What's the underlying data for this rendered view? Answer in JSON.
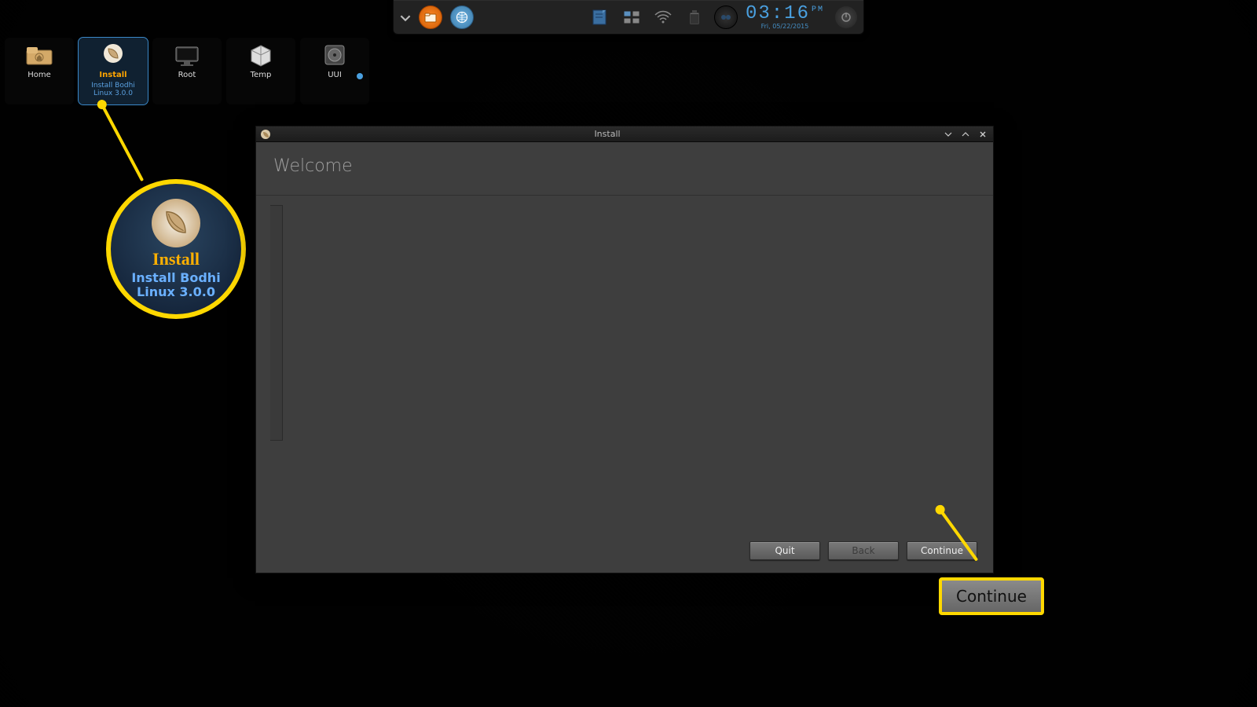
{
  "shelf": {
    "clock_time": "03:16",
    "clock_suffix": "PM",
    "clock_date": "Fri, 05/22/2015"
  },
  "desktop": {
    "icons": [
      {
        "label": "Home"
      },
      {
        "label_top": "Install",
        "label_bottom": "Install Bodhi Linux 3.0.0"
      },
      {
        "label": "Root"
      },
      {
        "label": "Temp"
      },
      {
        "label": "UUI"
      }
    ]
  },
  "callout_big": {
    "title": "Install",
    "subtitle": "Install Bodhi Linux 3.0.0"
  },
  "installer": {
    "window_title": "Install",
    "heading": "Welcome",
    "buttons": {
      "quit": "Quit",
      "back": "Back",
      "continue": "Continue"
    }
  },
  "callout_continue": {
    "label": "Continue"
  }
}
